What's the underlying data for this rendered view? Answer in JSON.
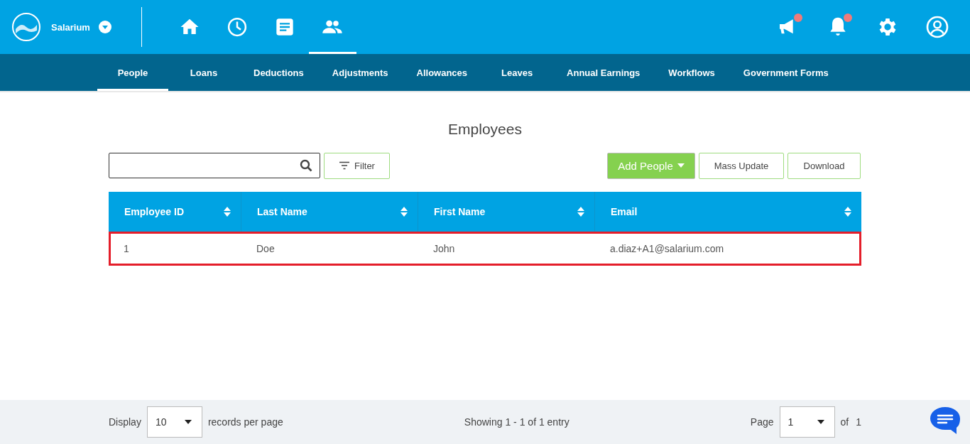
{
  "top_bar": {
    "brand": "Salarium",
    "nav_icons": [
      {
        "kind": "home",
        "selected": false
      },
      {
        "kind": "clock",
        "selected": false
      },
      {
        "kind": "document",
        "selected": false
      },
      {
        "kind": "people",
        "selected": true
      }
    ],
    "actions": [
      {
        "kind": "megaphone",
        "unread": true
      },
      {
        "kind": "bell",
        "unread": true
      },
      {
        "kind": "gear",
        "unread": false
      },
      {
        "kind": "user",
        "unread": false
      }
    ]
  },
  "tabs": [
    {
      "label": "People",
      "selected": true
    },
    {
      "label": "Loans",
      "selected": false
    },
    {
      "label": "Deductions",
      "selected": false
    },
    {
      "label": "Adjustments",
      "selected": false
    },
    {
      "label": "Allowances",
      "selected": false
    },
    {
      "label": "Leaves",
      "selected": false
    },
    {
      "label": "Annual Earnings",
      "selected": false
    },
    {
      "label": "Workflows",
      "selected": false
    },
    {
      "label": "Government Forms",
      "selected": false
    }
  ],
  "title": "Employees",
  "toolbar": {
    "filter": "Filter",
    "add": "Add People",
    "mass_update": "Mass Update",
    "download": "Download"
  },
  "table": {
    "columns": [
      "Employee ID",
      "Last Name",
      "First Name",
      "Email"
    ],
    "rows": [
      {
        "cells": [
          "1",
          "Doe",
          "John",
          "a.diaz+A1@salarium.com"
        ],
        "highlighted": true
      }
    ]
  },
  "footer": {
    "display": "Display",
    "page_size": "10",
    "per_page": "records per page",
    "showing": "Showing 1 - 1 of 1 entry",
    "page_label": "Page",
    "page": "1",
    "of": "of",
    "total": "1"
  }
}
